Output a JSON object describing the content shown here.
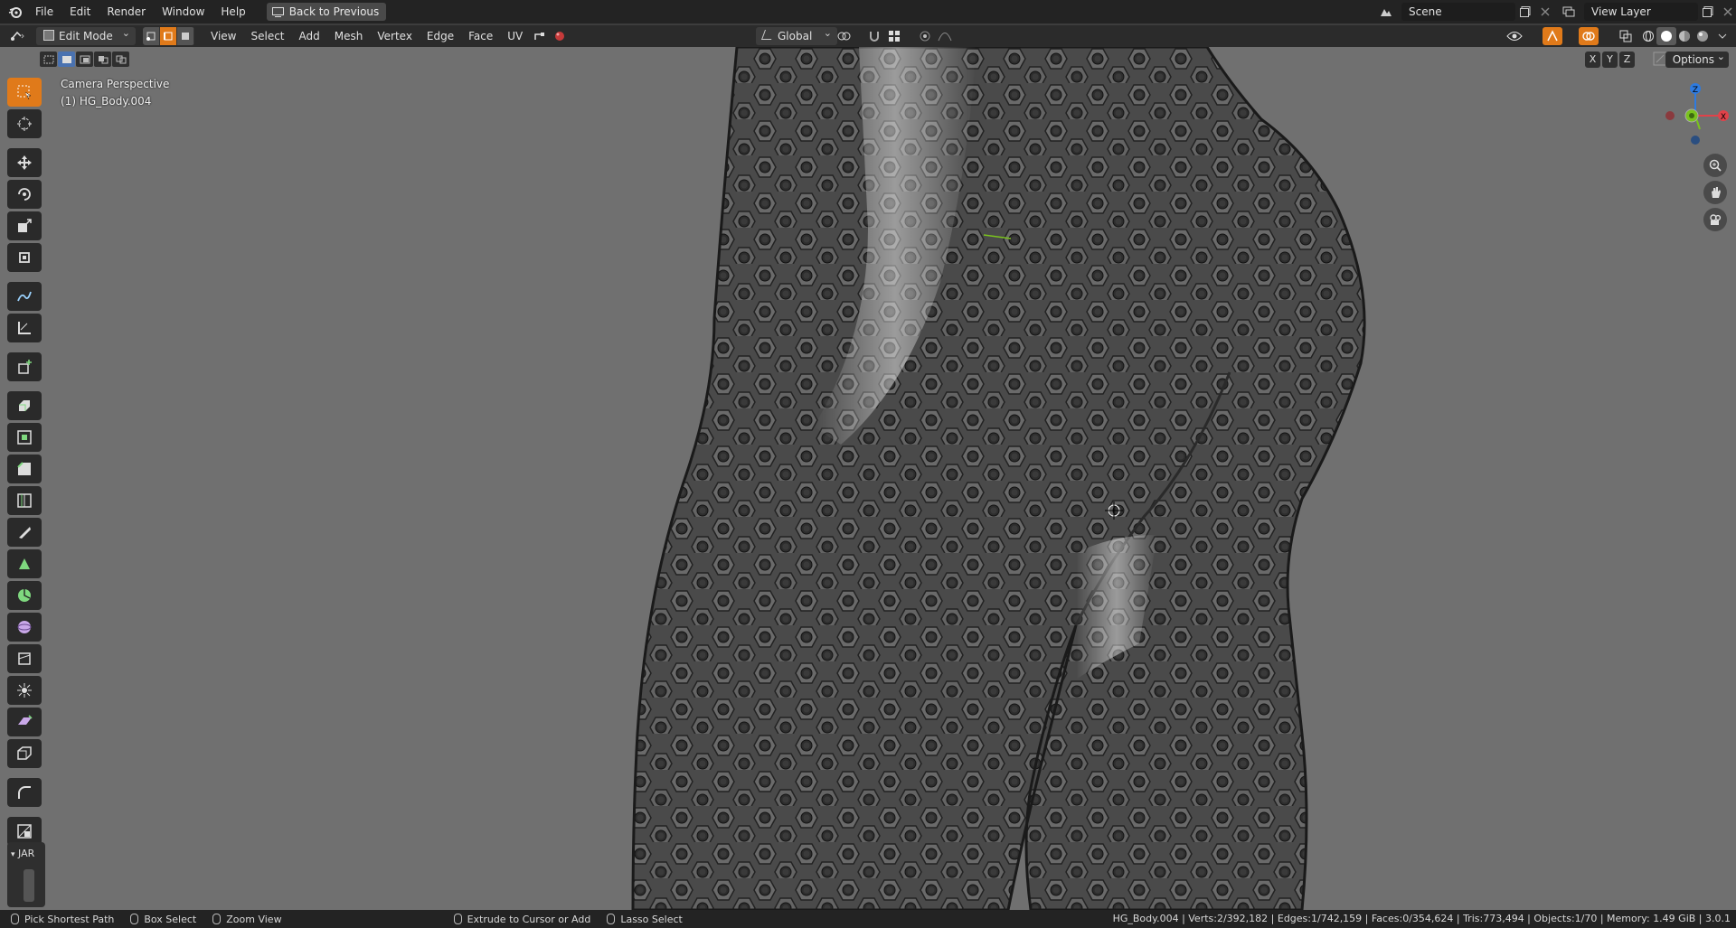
{
  "topbar": {
    "menus": [
      "File",
      "Edit",
      "Render",
      "Window",
      "Help"
    ],
    "back_label": "Back to Previous",
    "scene_name": "Scene",
    "view_layer": "View Layer"
  },
  "header": {
    "mode": "Edit Mode",
    "menus": [
      "View",
      "Select",
      "Add",
      "Mesh",
      "Vertex",
      "Edge",
      "Face",
      "UV"
    ],
    "orientation": "Global"
  },
  "viewport": {
    "camera_label": "Camera Perspective",
    "object_label": "(1) HG_Body.004",
    "axis_x": "X",
    "axis_y": "Y",
    "axis_z": "Z",
    "options_label": "Options",
    "gizmo_z": "Z",
    "gizmo_x": "X"
  },
  "tool_panel": {
    "label": "JAR"
  },
  "status": {
    "left": [
      "Pick Shortest Path",
      "Box Select",
      "Zoom View",
      "Extrude to Cursor or Add",
      "Lasso Select"
    ],
    "right": "HG_Body.004 | Verts:2/392,182 | Edges:1/742,159 | Faces:0/354,624 | Tris:773,494 | Objects:1/70 | Memory: 1.49 GiB | 3.0.1"
  },
  "colors": {
    "accent": "#e07a1a",
    "viewport_bg": "#707070",
    "topbar_bg": "#232323",
    "header_bg": "#2b2b2b",
    "axis_x": "#e0424a",
    "axis_y": "#7ac21e",
    "axis_z": "#2e7be0"
  }
}
